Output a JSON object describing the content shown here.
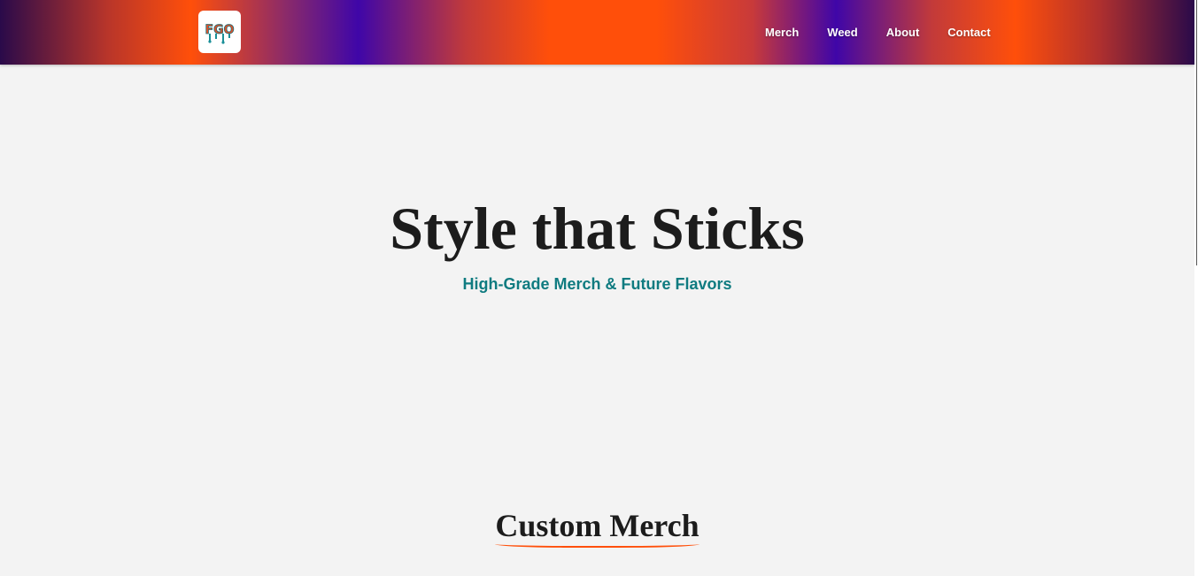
{
  "header": {
    "logo_text": "FGO",
    "nav": [
      {
        "label": "Merch"
      },
      {
        "label": "Weed"
      },
      {
        "label": "About"
      },
      {
        "label": "Contact"
      }
    ]
  },
  "hero": {
    "title": "Style that Sticks",
    "subtitle": "High-Grade Merch & Future Flavors"
  },
  "section": {
    "title": "Custom Merch"
  },
  "colors": {
    "accent": "#ff4f0a",
    "purple": "#3f06a8",
    "teal": "#0f7b80",
    "background": "#f3f3f3"
  }
}
